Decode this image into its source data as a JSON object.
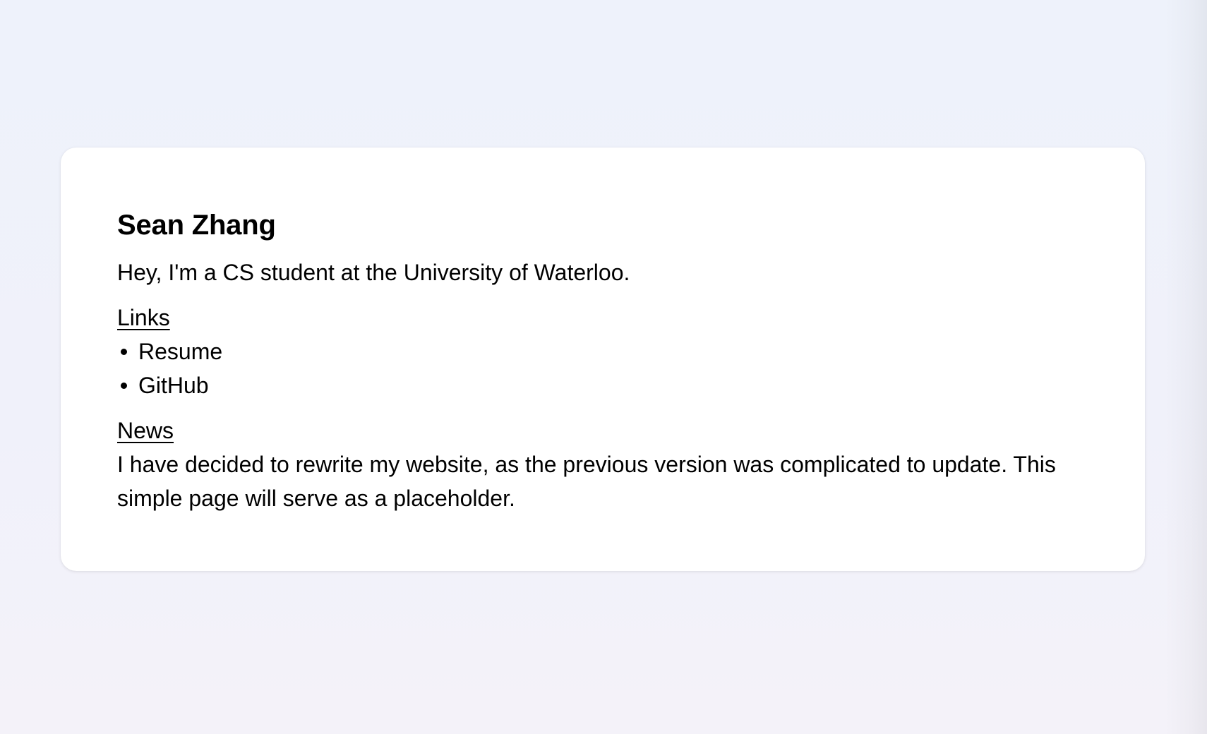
{
  "profile": {
    "name": "Sean Zhang",
    "intro": "Hey, I'm a CS student at the University of Waterloo."
  },
  "links": {
    "label": "Links",
    "items": [
      {
        "label": "Resume"
      },
      {
        "label": "GitHub"
      }
    ]
  },
  "news": {
    "label": "News",
    "body": "I have decided to rewrite my website, as the previous version was complicated to update. This simple page will serve as a placeholder."
  }
}
